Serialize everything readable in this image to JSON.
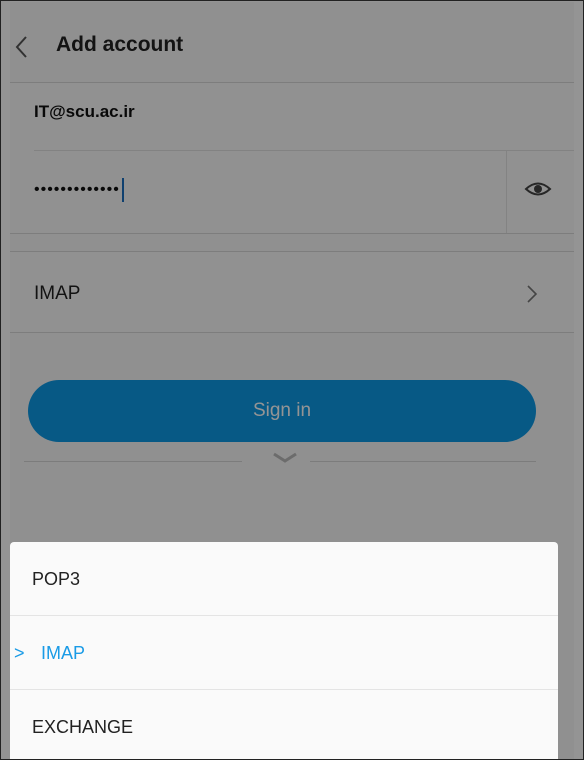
{
  "header": {
    "title": "Add account",
    "back_icon": "chevron-left-icon"
  },
  "account": {
    "email": "IT@scu.ac.ir",
    "password_masked": "•••••••••••••",
    "toggle_icon": "eye-icon"
  },
  "protocol": {
    "value": "IMAP",
    "chevron_icon": "chevron-right-icon"
  },
  "signin": {
    "label": "Sign in"
  },
  "sheet": {
    "options": [
      {
        "label": "POP3",
        "selected": false
      },
      {
        "label": "IMAP",
        "selected": true
      },
      {
        "label": "EXCHANGE",
        "selected": false
      }
    ],
    "selected_marker": ">"
  },
  "colors": {
    "accent": "#0d99e6",
    "selected_text": "#1a9be6",
    "caret": "#1a6fc0"
  }
}
